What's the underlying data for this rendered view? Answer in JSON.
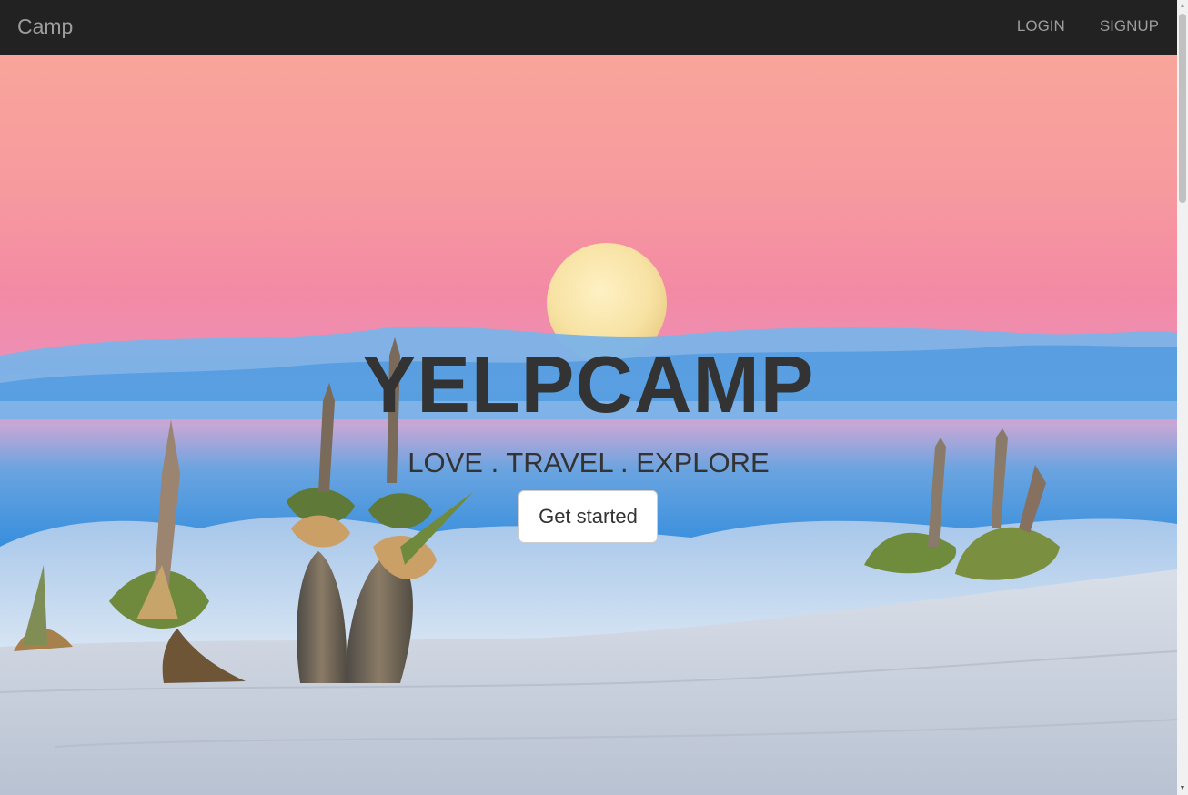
{
  "navbar": {
    "brand": "Camp",
    "links": [
      {
        "label": "LOGIN"
      },
      {
        "label": "SIGNUP"
      }
    ]
  },
  "hero": {
    "title": "YELPCAMP",
    "subtitle": "LOVE . TRAVEL . EXPLORE",
    "cta_label": "Get started",
    "background_image": "white sands desert at dusk with full moon, yucca plants and clouds"
  },
  "scrollbar": {
    "up_arrow": "▲",
    "down_arrow": "▼"
  },
  "colors": {
    "navbar_bg": "#222222",
    "nav_text": "#9d9d9d",
    "hero_text": "#333333",
    "button_bg": "#ffffff"
  }
}
